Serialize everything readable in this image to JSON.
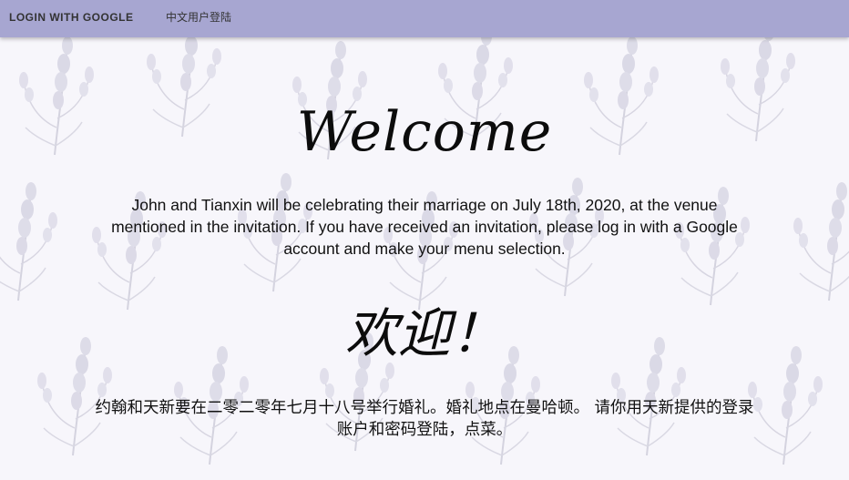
{
  "nav": {
    "google_login_label": "LOGIN WITH GOOGLE",
    "chinese_login_label": "中文用户登陆"
  },
  "main": {
    "title_en": "Welcome",
    "message_en": "John and Tianxin will be celebrating their marriage on July 18th, 2020, at the venue mentioned in the invitation. If you have received an invitation, please log in with a Google account and make your menu selection.",
    "title_zh": "欢迎！",
    "message_zh": "约翰和天新要在二零二零年七月十八号举行婚礼。婚礼地点在曼哈顿。 请你用天新提供的登录账户和密码登陆，点菜。"
  },
  "theme": {
    "navbar_color": "#a7a6d1",
    "background_color": "#f7f6fb",
    "pattern": "lavender-sprigs"
  }
}
